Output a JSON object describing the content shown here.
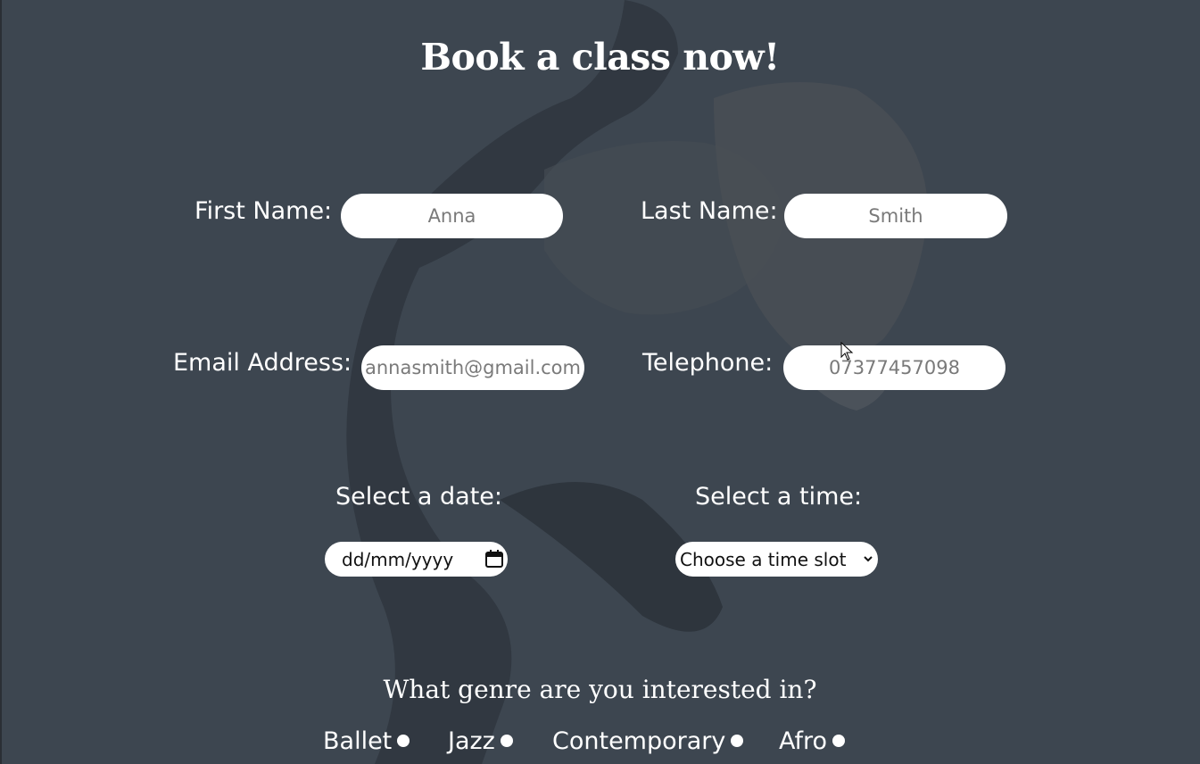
{
  "form": {
    "title": "Book a class now!",
    "first_name": {
      "label": "First Name:",
      "placeholder": "Anna"
    },
    "last_name": {
      "label": "Last Name:",
      "placeholder": "Smith"
    },
    "email": {
      "label": "Email Address:",
      "placeholder": "annasmith@gmail.com"
    },
    "telephone": {
      "label": "Telephone:",
      "placeholder": "07377457098"
    },
    "date": {
      "label": "Select a date:",
      "value": "dd/mm/yyyy",
      "icon": "calendar-icon"
    },
    "time": {
      "label": "Select a time:",
      "selected": "Choose a time slot",
      "icon": "chevron-down-icon"
    },
    "genre": {
      "question": "What genre are you interested in?",
      "options": [
        "Ballet",
        "Jazz",
        "Contemporary",
        "Afro"
      ]
    }
  },
  "colors": {
    "background": "#3d4650",
    "text": "#ffffff",
    "field": "#ffffff",
    "placeholder": "#7a7a7a"
  }
}
